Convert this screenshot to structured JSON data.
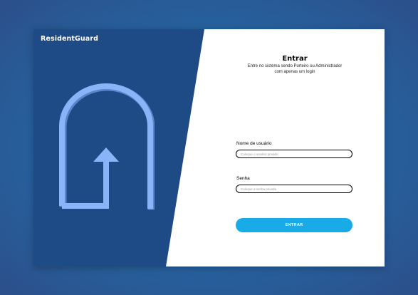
{
  "brand": {
    "name": "ResidentGuard"
  },
  "login": {
    "title": "Entrar",
    "subtitle_line1": "Entre no sistema sendo Porteiro ou Administrador",
    "subtitle_line2": "com apenas um login",
    "username": {
      "label": "Nome de usuário",
      "placeholder": "Coloque o usuário privado",
      "value": ""
    },
    "password": {
      "label": "Senha",
      "placeholder": "Coloque a senha privada",
      "value": ""
    },
    "submit_label": "ENTRAR"
  },
  "colors": {
    "panel": "#1e4a85",
    "logo": "#8ab4f8",
    "button": "#18abe8",
    "background": "#2466a3"
  },
  "icons": {
    "logo": "arch-arrow-icon"
  }
}
